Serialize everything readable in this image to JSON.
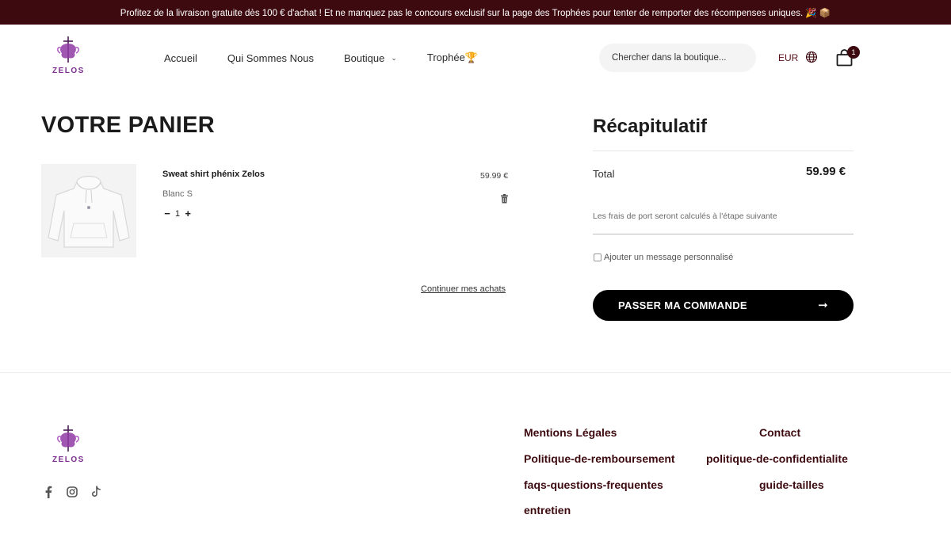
{
  "announcement": "Profitez de la livraison gratuite dès 100 € d'achat ! Et ne manquez pas le concours exclusif sur la page des Trophées pour tenter de remporter des récompenses uniques. 🎉 📦",
  "brand": {
    "logo_text": "ZELOS"
  },
  "nav": {
    "items": [
      {
        "label": "Accueil"
      },
      {
        "label": "Qui Sommes Nous"
      },
      {
        "label": "Boutique"
      },
      {
        "label": "Trophée🏆"
      }
    ]
  },
  "search": {
    "placeholder": "Chercher dans la boutique..."
  },
  "currency": "EUR",
  "cart": {
    "count": "1"
  },
  "cart_page": {
    "title": "VOTRE PANIER",
    "items": [
      {
        "name": "Sweat shirt phénix Zelos",
        "variant": "Blanc S",
        "quantity": "1",
        "minus": "−",
        "plus": "+",
        "price": "59.99 €"
      }
    ],
    "continue_label": "Continuer mes achats"
  },
  "summary": {
    "title": "Récapitulatif",
    "total_label": "Total",
    "total_value": "59.99 €",
    "shipping_note": "Les frais de port seront calculés à l'étape suivante",
    "message_label": "Ajouter un message personnalisé",
    "checkout_label": "PASSER MA COMMANDE",
    "checkout_arrow": "➞"
  },
  "footer": {
    "links_col1": [
      {
        "label": "Mentions Légales"
      },
      {
        "label": "Politique-de-remboursement"
      },
      {
        "label": "faqs-questions-frequentes"
      },
      {
        "label": "entretien"
      }
    ],
    "links_col2": [
      {
        "label": "Contact"
      },
      {
        "label": "politique-de-confidentialite"
      },
      {
        "label": "guide-tailles"
      }
    ],
    "social": [
      "facebook-icon",
      "instagram-icon",
      "tiktok-icon"
    ]
  },
  "colors": {
    "brand_dark": "#3d0a0f",
    "logo_purple": "#7b2f8e",
    "button_black": "#000000"
  }
}
